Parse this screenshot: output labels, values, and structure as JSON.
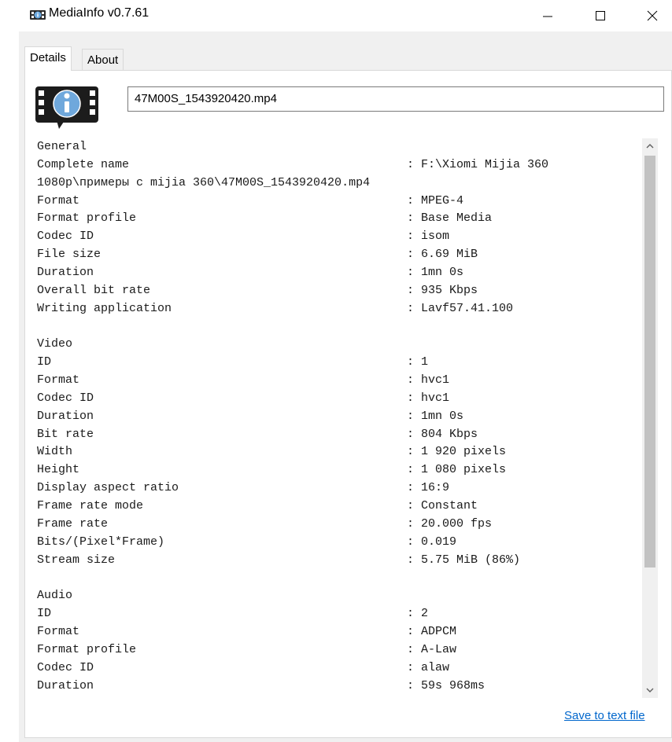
{
  "window": {
    "title": "MediaInfo v0.7.61",
    "icon": "mediainfo-app-icon"
  },
  "tabs": [
    {
      "label": "Details",
      "selected": true
    },
    {
      "label": "About",
      "selected": false
    }
  ],
  "file": {
    "name": "47M00S_1543920420.mp4"
  },
  "info_lines": [
    {
      "label": "General",
      "value": ""
    },
    {
      "label": "Complete name",
      "value": ": F:\\Xiomi Mijia 360"
    },
    {
      "label": "1080p\\примеры с mijia 360\\47M00S_1543920420.mp4",
      "value": ""
    },
    {
      "label": "Format",
      "value": ": MPEG-4"
    },
    {
      "label": "Format profile",
      "value": ": Base Media"
    },
    {
      "label": "Codec ID",
      "value": ": isom"
    },
    {
      "label": "File size",
      "value": ": 6.69 MiB"
    },
    {
      "label": "Duration",
      "value": ": 1mn 0s"
    },
    {
      "label": "Overall bit rate",
      "value": ": 935 Kbps"
    },
    {
      "label": "Writing application",
      "value": ": Lavf57.41.100"
    },
    {
      "label": "",
      "value": ""
    },
    {
      "label": "Video",
      "value": ""
    },
    {
      "label": "ID",
      "value": ": 1"
    },
    {
      "label": "Format",
      "value": ": hvc1"
    },
    {
      "label": "Codec ID",
      "value": ": hvc1"
    },
    {
      "label": "Duration",
      "value": ": 1mn 0s"
    },
    {
      "label": "Bit rate",
      "value": ": 804 Kbps"
    },
    {
      "label": "Width",
      "value": ": 1 920 pixels"
    },
    {
      "label": "Height",
      "value": ": 1 080 pixels"
    },
    {
      "label": "Display aspect ratio",
      "value": ": 16:9"
    },
    {
      "label": "Frame rate mode",
      "value": ": Constant"
    },
    {
      "label": "Frame rate",
      "value": ": 20.000 fps"
    },
    {
      "label": "Bits/(Pixel*Frame)",
      "value": ": 0.019"
    },
    {
      "label": "Stream size",
      "value": ": 5.75 MiB (86%)"
    },
    {
      "label": "",
      "value": ""
    },
    {
      "label": "Audio",
      "value": ""
    },
    {
      "label": "ID",
      "value": ": 2"
    },
    {
      "label": "Format",
      "value": ": ADPCM"
    },
    {
      "label": "Format profile",
      "value": ": A-Law"
    },
    {
      "label": "Codec ID",
      "value": ": alaw"
    },
    {
      "label": "Duration",
      "value": ": 59s 968ms"
    }
  ],
  "footer": {
    "save_link": "Save to text file"
  },
  "colors": {
    "link": "#0066cc",
    "window_bg": "#f0f0f0",
    "scroll_thumb": "#c2c2c2"
  }
}
